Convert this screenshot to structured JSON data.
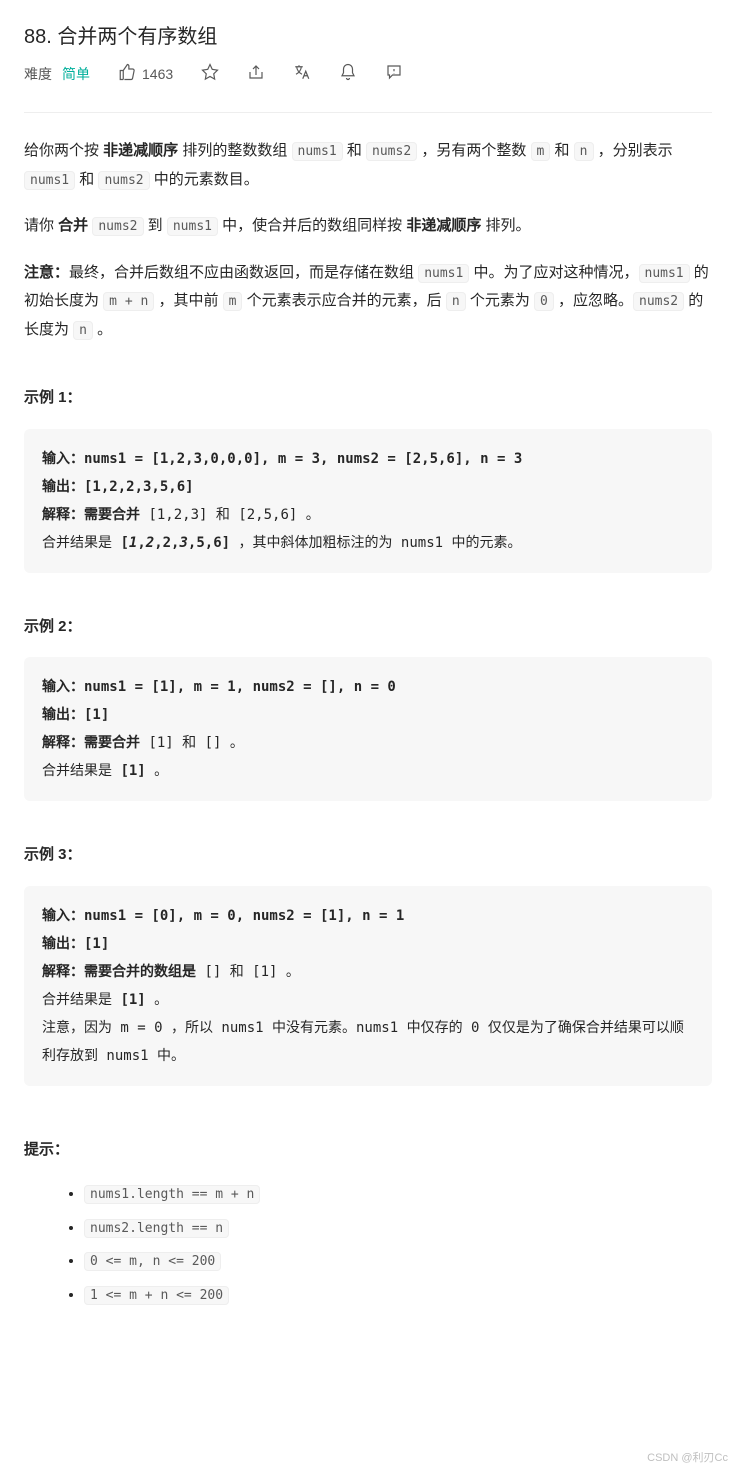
{
  "title": "88. 合并两个有序数组",
  "toolbar": {
    "diff_label": "难度",
    "diff_value": "简单",
    "likes": "1463"
  },
  "desc": {
    "p1_a": "给你两个按 ",
    "p1_strong": "非递减顺序",
    "p1_b": " 排列的整数数组 ",
    "p1_c1": "nums1",
    "p1_d": " 和 ",
    "p1_c2": "nums2",
    "p1_e": " ，另有两个整数 ",
    "p1_c3": "m",
    "p1_f": " 和 ",
    "p1_c4": "n",
    "p1_g": " ，分别表示 ",
    "p1_c5": "nums1",
    "p1_h": " 和 ",
    "p1_c6": "nums2",
    "p1_i": " 中的元素数目。",
    "p2_a": "请你 ",
    "p2_strong": "合并",
    "p2_b": " ",
    "p2_c1": "nums2",
    "p2_c": " 到 ",
    "p2_c2": "nums1",
    "p2_d": " 中，使合并后的数组同样按 ",
    "p2_strong2": "非递减顺序",
    "p2_e": " 排列。",
    "p3_strong": "注意：",
    "p3_a": "最终，合并后数组不应由函数返回，而是存储在数组 ",
    "p3_c1": "nums1",
    "p3_b": " 中。为了应对这种情况，",
    "p3_c2": "nums1",
    "p3_c": " 的初始长度为 ",
    "p3_c3": "m + n",
    "p3_d": " ，其中前 ",
    "p3_c4": "m",
    "p3_e": " 个元素表示应合并的元素，后 ",
    "p3_c5": "n",
    "p3_f": " 个元素为 ",
    "p3_c6": "0",
    "p3_g": " ，应忽略。",
    "p3_c7": "nums2",
    "p3_h": " 的长度为 ",
    "p3_c8": "n",
    "p3_i": " 。"
  },
  "examples": {
    "h1": "示例 1：",
    "e1": {
      "l1": "输入：nums1 = [1,2,3,0,0,0], m = 3, nums2 = [2,5,6], n = 3",
      "l2": "输出：[1,2,2,3,5,6]",
      "l3a": "解释：需要合并 ",
      "l3b": "[1,2,3]",
      "l3c": " 和 ",
      "l3d": "[2,5,6]",
      "l3e": " 。",
      "l4a": "合并结果是 ",
      "l4b": "[",
      "l4_1": "1",
      "l4_s": ",",
      "l4_2": "2",
      "l4_3": ",2,",
      "l4_4": "3",
      "l4_5": ",5,6]",
      "l4c": " ，其中斜体加粗标注的为 nums1 中的元素。"
    },
    "h2": "示例 2：",
    "e2": {
      "l1": "输入：nums1 = [1], m = 1, nums2 = [], n = 0",
      "l2": "输出：[1]",
      "l3a": "解释：需要合并 ",
      "l3b": "[1]",
      "l3c": " 和 ",
      "l3d": "[]",
      "l3e": " 。",
      "l4a": "合并结果是 ",
      "l4b": "[1]",
      "l4c": " 。"
    },
    "h3": "示例 3：",
    "e3": {
      "l1": "输入：nums1 = [0], m = 0, nums2 = [1], n = 1",
      "l2": "输出：[1]",
      "l3a": "解释：需要合并的数组是 ",
      "l3b": "[]",
      "l3c": " 和 ",
      "l3d": "[1]",
      "l3e": " 。",
      "l4a": "合并结果是 ",
      "l4b": "[1]",
      "l4c": " 。",
      "l5": "注意，因为 m = 0 ，所以 nums1 中没有元素。nums1 中仅存的 0 仅仅是为了确保合并结果可以顺利存放到 nums1 中。"
    }
  },
  "hints": {
    "title": "提示：",
    "items": [
      "nums1.length == m + n",
      "nums2.length == n",
      "0 <= m, n <= 200",
      "1 <= m + n <= 200"
    ]
  },
  "watermark": "CSDN @利刃Cc"
}
